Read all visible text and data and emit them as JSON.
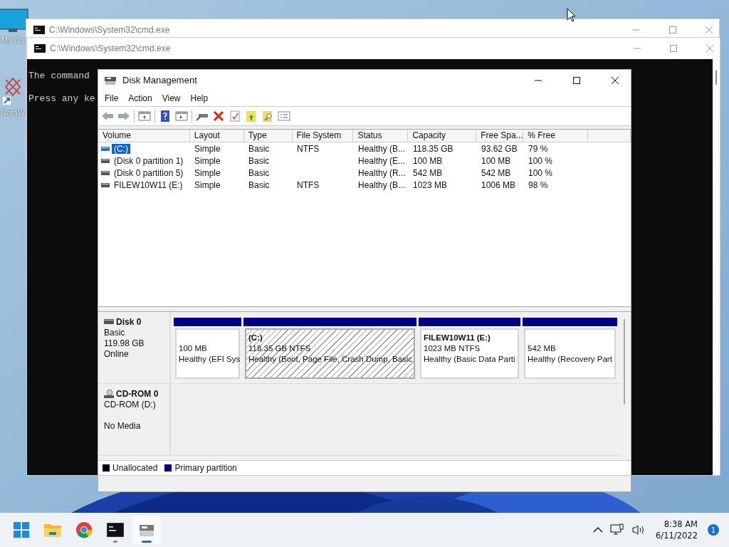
{
  "desktop_icons": [
    {
      "label": "My Co",
      "kind": "computer"
    },
    {
      "label": "DataW",
      "kind": "shortcut"
    }
  ],
  "cmd_windows": [
    {
      "title": "C:\\Windows\\System32\\cmd.exe"
    },
    {
      "title": "C:\\Windows\\System32\\cmd.exe",
      "lines": [
        "The command",
        "Press any ke"
      ]
    }
  ],
  "disk_management": {
    "title": "Disk Management",
    "menu": [
      "File",
      "Action",
      "View",
      "Help"
    ],
    "columns": [
      "Volume",
      "Layout",
      "Type",
      "File System",
      "Status",
      "Capacity",
      "Free Spa...",
      "% Free",
      ""
    ],
    "rows": [
      {
        "cells": [
          "(C:)",
          "Simple",
          "Basic",
          "NTFS",
          "Healthy (B...",
          "118.35 GB",
          "93.62 GB",
          "79 %"
        ],
        "selected": true
      },
      {
        "cells": [
          "(Disk 0 partition 1)",
          "Simple",
          "Basic",
          "",
          "Healthy (E...",
          "100 MB",
          "100 MB",
          "100 %"
        ],
        "selected": false
      },
      {
        "cells": [
          "(Disk 0 partition 5)",
          "Simple",
          "Basic",
          "",
          "Healthy (R...",
          "542 MB",
          "542 MB",
          "100 %"
        ],
        "selected": false
      },
      {
        "cells": [
          "FILEW10W11 (E:)",
          "Simple",
          "Basic",
          "NTFS",
          "Healthy (B...",
          "1023 MB",
          "1006 MB",
          "98 %"
        ],
        "selected": false
      }
    ],
    "disks": [
      {
        "kind": "disk",
        "name": "Disk 0",
        "info": [
          "Basic",
          "119.98 GB",
          "Online"
        ],
        "partitions": [
          {
            "size": "100 MB",
            "status": "Healthy (EFI Sys",
            "selected": false
          },
          {
            "label": "(C:)",
            "size": "118.35 GB NTFS",
            "status": "Healthy (Boot, Page File, Crash Dump, Basic",
            "selected": true
          },
          {
            "label": "FILEW10W11  (E:)",
            "size": "1023 MB NTFS",
            "status": "Healthy (Basic Data Parti",
            "selected": false
          },
          {
            "size": "542 MB",
            "status": "Healthy (Recovery Part",
            "selected": false
          }
        ]
      },
      {
        "kind": "cdrom",
        "name": "CD-ROM 0",
        "info": [
          "CD-ROM (D:)",
          "No Media"
        ]
      }
    ],
    "legend": [
      {
        "label": "Unallocated",
        "color": "#000000"
      },
      {
        "label": "Primary partition",
        "color": "#000080"
      }
    ]
  },
  "taskbar": {
    "apps": [
      {
        "kind": "start",
        "running": false,
        "active": false
      },
      {
        "kind": "explorer",
        "running": false,
        "active": false
      },
      {
        "kind": "chrome",
        "running": false,
        "active": false
      },
      {
        "kind": "cmd",
        "running": true,
        "active": false
      },
      {
        "kind": "disk",
        "running": true,
        "active": true
      }
    ],
    "time": "8:38 AM",
    "date": "6/11/2022",
    "notifications": "1"
  }
}
